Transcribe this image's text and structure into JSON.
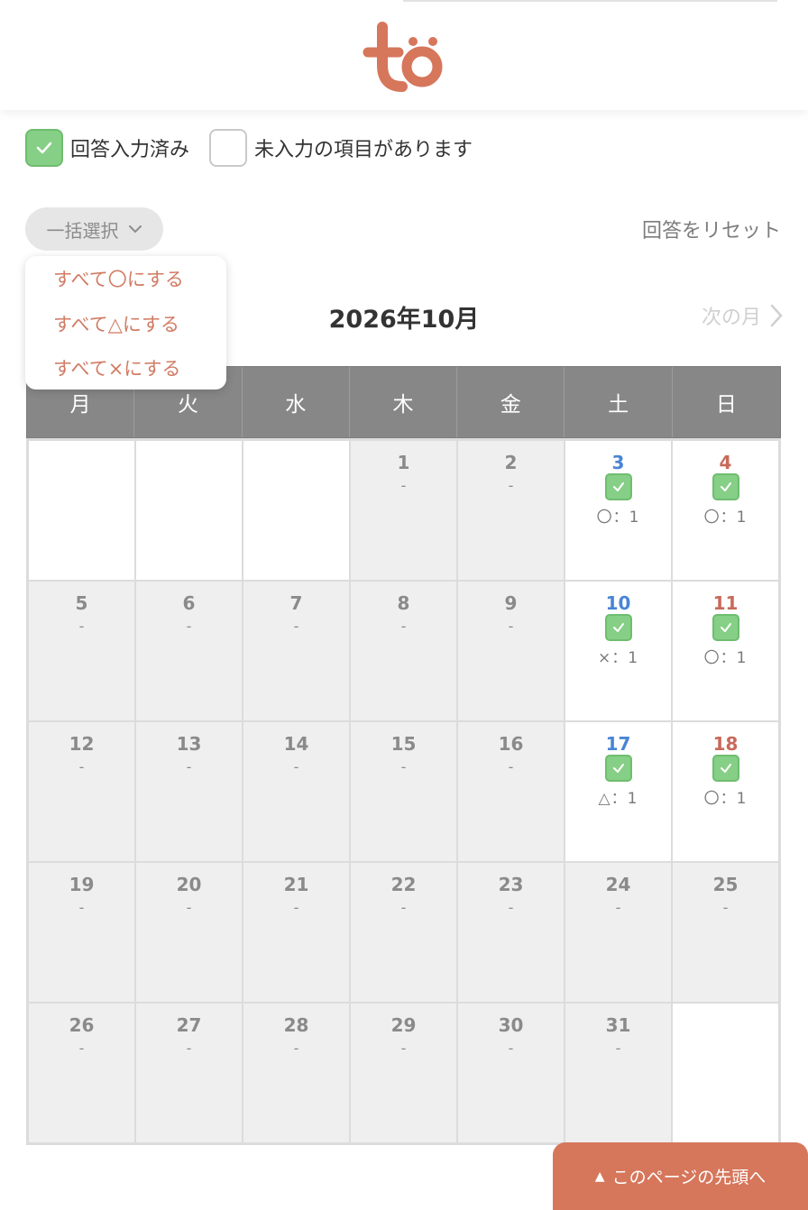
{
  "legend": {
    "done_label": "回答入力済み",
    "todo_label": "未入力の項目があります"
  },
  "toolbar": {
    "bulk_label": "一括選択",
    "reset_label": "回答をリセット"
  },
  "bulk_menu": [
    "すべて〇にする",
    "すべて△にする",
    "すべて×にする"
  ],
  "month": {
    "title": "2026年10月",
    "next_label": "次の月"
  },
  "weekdays": [
    "月",
    "火",
    "水",
    "木",
    "金",
    "土",
    "日"
  ],
  "days": [
    {
      "num": "",
      "white": true
    },
    {
      "num": "",
      "white": true
    },
    {
      "num": "",
      "white": true
    },
    {
      "num": "1",
      "note": "-"
    },
    {
      "num": "2",
      "note": "-"
    },
    {
      "num": "3",
      "type": "sat",
      "white": true,
      "check": true,
      "answer": "〇：1"
    },
    {
      "num": "4",
      "type": "sun",
      "white": true,
      "check": true,
      "answer": "〇：1"
    },
    {
      "num": "5",
      "note": "-"
    },
    {
      "num": "6",
      "note": "-"
    },
    {
      "num": "7",
      "note": "-"
    },
    {
      "num": "8",
      "note": "-"
    },
    {
      "num": "9",
      "note": "-"
    },
    {
      "num": "10",
      "type": "sat",
      "white": true,
      "check": true,
      "answer": "×：1"
    },
    {
      "num": "11",
      "type": "sun",
      "white": true,
      "check": true,
      "answer": "〇：1"
    },
    {
      "num": "12",
      "note": "-"
    },
    {
      "num": "13",
      "note": "-"
    },
    {
      "num": "14",
      "note": "-"
    },
    {
      "num": "15",
      "note": "-"
    },
    {
      "num": "16",
      "note": "-"
    },
    {
      "num": "17",
      "type": "sat",
      "white": true,
      "check": true,
      "answer": "△：1"
    },
    {
      "num": "18",
      "type": "sun",
      "white": true,
      "check": true,
      "answer": "〇：1"
    },
    {
      "num": "19",
      "note": "-"
    },
    {
      "num": "20",
      "note": "-"
    },
    {
      "num": "21",
      "note": "-"
    },
    {
      "num": "22",
      "note": "-"
    },
    {
      "num": "23",
      "note": "-"
    },
    {
      "num": "24",
      "note": "-"
    },
    {
      "num": "25",
      "note": "-"
    },
    {
      "num": "26",
      "note": "-"
    },
    {
      "num": "27",
      "note": "-"
    },
    {
      "num": "28",
      "note": "-"
    },
    {
      "num": "29",
      "note": "-"
    },
    {
      "num": "30",
      "note": "-"
    },
    {
      "num": "31",
      "note": "-"
    },
    {
      "num": "",
      "white": true
    }
  ],
  "footer": {
    "to_top_label": "このページの先頭へ"
  },
  "colors": {
    "accent": "#d6765b",
    "check_green": "#86cf86",
    "saturday": "#4a84d4",
    "sunday": "#c86a5a",
    "header_gray": "#878787"
  }
}
